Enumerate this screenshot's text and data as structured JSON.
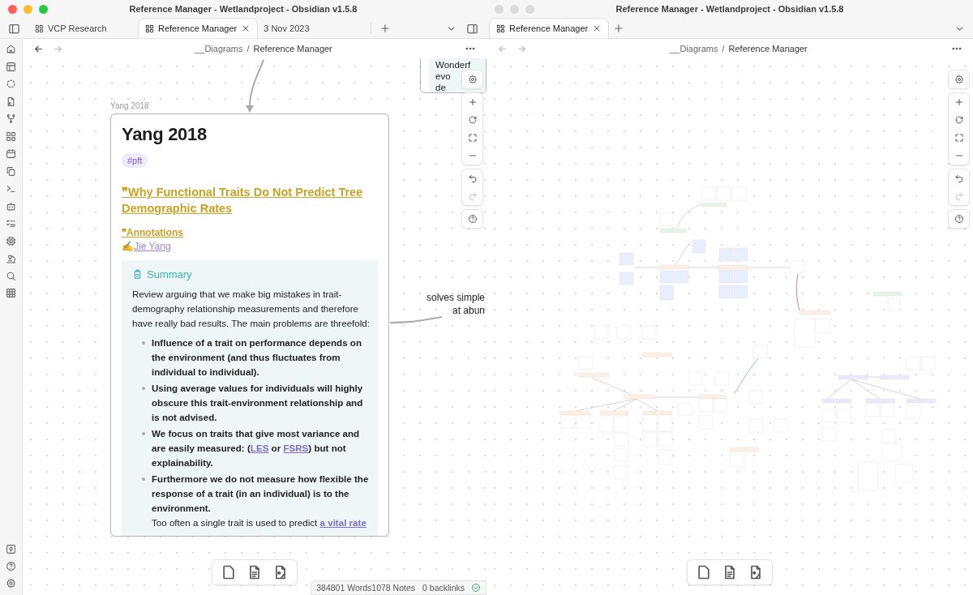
{
  "windows": [
    {
      "title": "Reference Manager - Wetlandproject - Obsidian v1.5.8",
      "focused": true,
      "ribbon": true,
      "back_enabled": true,
      "can_redo": false,
      "tabs": [
        {
          "label": "VCP Research",
          "kind": "canvas",
          "selected": false
        },
        {
          "label": "Reference Manager",
          "kind": "canvas",
          "selected": true
        },
        {
          "label": "3 Nov 2023",
          "kind": "note",
          "selected": false
        }
      ],
      "breadcrumb": {
        "folder": "__Diagrams",
        "separator": "/",
        "file": "Reference Manager"
      },
      "canvas": {
        "kind": "detail",
        "card_label": "Yang 2018",
        "partial_card": [
          "Wonderf",
          "evo",
          "de"
        ],
        "edge_label": [
          "solves simple",
          "at abun"
        ],
        "card": {
          "heading": "Yang 2018",
          "tag": "#pft",
          "title_link": "❞Why Functional Traits Do Not Predict Tree Demographic Rates",
          "annotations_link": "❞Annotations",
          "author_icon": "✍",
          "author": "Jie Yang",
          "callout": {
            "title": "Summary",
            "paragraph": "Review arguing that we make big mistakes in trait-demography relationship measurements and therefore have really bad results. The main problems are threefold:",
            "bullets": [
              [
                {
                  "kind": "bold",
                  "text": "Influence of a trait on performance depends on the environment (and thus fluctuates from individual to individual)."
                }
              ],
              [
                {
                  "kind": "bold",
                  "text": "Using average values for individuals will highly obscure this trait-environment relationship and is not advised."
                }
              ],
              [
                {
                  "kind": "bold",
                  "text": "We focus on traits that give most variance and are easily measured: ("
                },
                {
                  "kind": "link",
                  "text": "LES"
                },
                {
                  "kind": "bold",
                  "text": " or "
                },
                {
                  "kind": "link",
                  "text": "FSRS"
                },
                {
                  "kind": "bold",
                  "text": ") but not explainability."
                }
              ],
              [
                {
                  "kind": "bold",
                  "text": "Furthermore we do not measure how flexible the response of a trait (in an individual) is to the environment."
                },
                {
                  "kind": "break"
                },
                {
                  "kind": "plain",
                  "text": "Too often a single trait is used to predict "
                },
                {
                  "kind": "link",
                  "text": "a vital rate"
                }
              ]
            ]
          }
        }
      },
      "status_bar": {
        "words": "384801 Words",
        "notes": "1078 Notes",
        "backlinks": "0 backlinks",
        "synced": true
      }
    },
    {
      "title": "Reference Manager - Wetlandproject - Obsidian v1.5.8",
      "focused": false,
      "ribbon": false,
      "back_enabled": false,
      "can_redo": false,
      "tabs": [
        {
          "label": "Reference Manager",
          "kind": "canvas",
          "selected": true
        }
      ],
      "breadcrumb": {
        "folder": "__Diagrams",
        "separator": "/",
        "file": "Reference Manager"
      },
      "canvas": {
        "kind": "overview"
      }
    }
  ]
}
